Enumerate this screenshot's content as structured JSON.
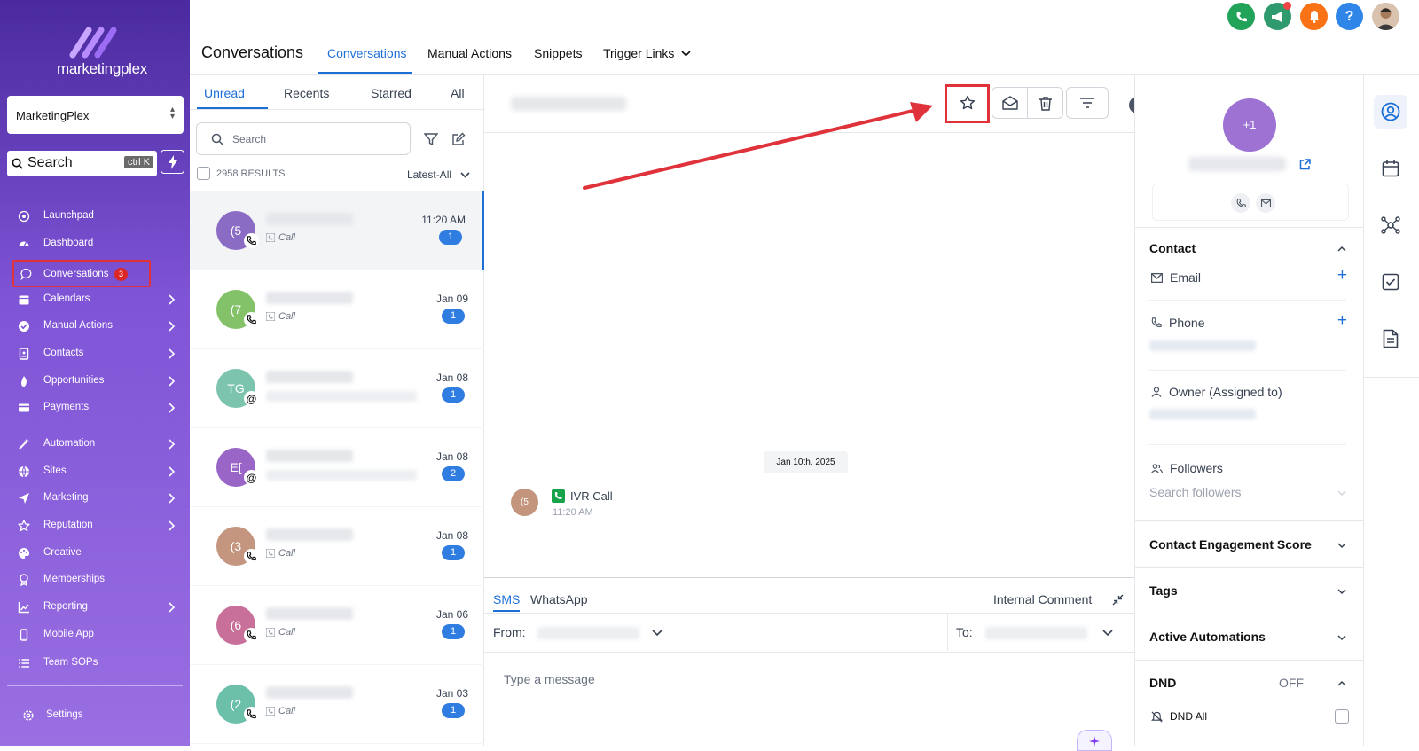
{
  "sidebar": {
    "logo_text": "marketingplex",
    "account": "MarketingPlex",
    "search_label": "Search",
    "search_shortcut": "ctrl K",
    "items": [
      {
        "label": "Launchpad",
        "icon": "rocket-icon",
        "chevron": false
      },
      {
        "label": "Dashboard",
        "icon": "gauge-icon",
        "chevron": false
      },
      {
        "label": "Conversations",
        "icon": "chat-icon",
        "chevron": false,
        "badge": "3"
      },
      {
        "label": "Calendars",
        "icon": "calendar-icon",
        "chevron": true
      },
      {
        "label": "Manual Actions",
        "icon": "check-circle-icon",
        "chevron": true
      },
      {
        "label": "Contacts",
        "icon": "contact-book-icon",
        "chevron": true
      },
      {
        "label": "Opportunities",
        "icon": "flame-icon",
        "chevron": true
      },
      {
        "label": "Payments",
        "icon": "card-icon",
        "chevron": true
      },
      {
        "label": "Automation",
        "icon": "wand-icon",
        "chevron": true
      },
      {
        "label": "Sites",
        "icon": "globe-icon",
        "chevron": true
      },
      {
        "label": "Marketing",
        "icon": "send-icon",
        "chevron": true
      },
      {
        "label": "Reputation",
        "icon": "star-icon",
        "chevron": true
      },
      {
        "label": "Creative",
        "icon": "palette-icon",
        "chevron": false
      },
      {
        "label": "Memberships",
        "icon": "award-icon",
        "chevron": false
      },
      {
        "label": "Reporting",
        "icon": "chart-icon",
        "chevron": true
      },
      {
        "label": "Mobile App",
        "icon": "phone-device-icon",
        "chevron": false
      },
      {
        "label": "Team SOPs",
        "icon": "list-icon",
        "chevron": false
      }
    ],
    "settings_label": "Settings"
  },
  "header": {
    "title": "Conversations",
    "tabs": [
      "Conversations",
      "Manual Actions",
      "Snippets",
      "Trigger Links"
    ],
    "icons": [
      {
        "name": "phone-icon",
        "color": "#22a35a"
      },
      {
        "name": "megaphone-icon",
        "color": "#2f9a6e"
      },
      {
        "name": "bell-icon",
        "color": "#f97316"
      },
      {
        "name": "help-icon",
        "color": "#2f86e8"
      }
    ]
  },
  "list": {
    "tabs": [
      "Unread",
      "Recents",
      "Starred",
      "All"
    ],
    "search_placeholder": "Search",
    "results": "2958 RESULTS",
    "sort": "Latest-All",
    "rows": [
      {
        "initials": "(5",
        "color": "#8b6cc4",
        "channel": "call",
        "sub": "Call",
        "time": "11:20 AM",
        "count": "1"
      },
      {
        "initials": "(7",
        "color": "#84c26a",
        "channel": "call",
        "sub": "Call",
        "time": "Jan 09",
        "count": "1"
      },
      {
        "initials": "TG",
        "color": "#7cc4ad",
        "channel": "email",
        "sub": "",
        "time": "Jan 08",
        "count": "1"
      },
      {
        "initials": "E[",
        "color": "#9966c7",
        "channel": "email",
        "sub": "",
        "time": "Jan 08",
        "count": "2"
      },
      {
        "initials": "(3",
        "color": "#c49680",
        "channel": "call",
        "sub": "Call",
        "time": "Jan 08",
        "count": "1"
      },
      {
        "initials": "(6",
        "color": "#c8709a",
        "channel": "call",
        "sub": "Call",
        "time": "Jan 06",
        "count": "1"
      },
      {
        "initials": "(2",
        "color": "#6cbfa9",
        "channel": "call",
        "sub": "Call",
        "time": "Jan 03",
        "count": "1"
      }
    ]
  },
  "thread": {
    "date_divider": "Jan 10th, 2025",
    "message": {
      "initials": "(5",
      "label": "IVR Call",
      "time": "11:20 AM"
    },
    "composer": {
      "tabs": [
        "SMS",
        "WhatsApp"
      ],
      "internal": "Internal Comment",
      "from_label": "From:",
      "to_label": "To:",
      "placeholder": "Type a message"
    }
  },
  "contact_panel": {
    "avatar_text": "+1",
    "contact_heading": "Contact",
    "email_label": "Email",
    "phone_label": "Phone",
    "owner_label": "Owner (Assigned to)",
    "followers_label": "Followers",
    "followers_placeholder": "Search followers",
    "engagement": "Contact Engagement Score",
    "tags": "Tags",
    "automations": "Active Automations",
    "dnd": "DND",
    "dnd_state": "OFF",
    "dnd_all": "DND All"
  },
  "colors": {
    "accent": "#1d6fd8",
    "highlight": "#e0323a",
    "sidebar": "#7f54d6"
  }
}
